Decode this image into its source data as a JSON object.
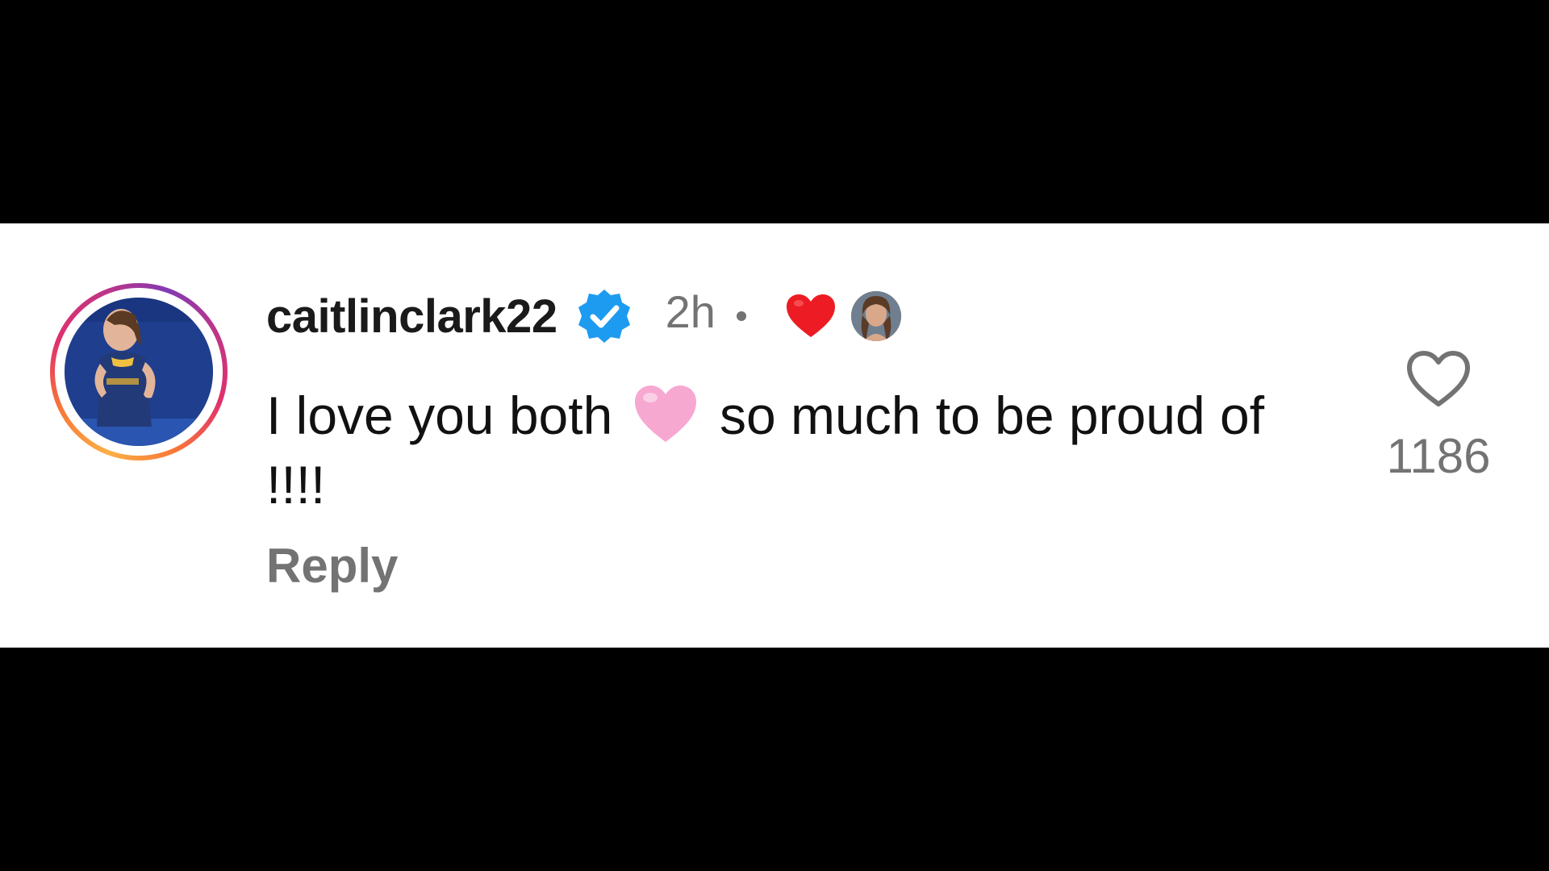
{
  "comment": {
    "username": "caitlinclark22",
    "verified": true,
    "time": "2h",
    "liked_by_author": true,
    "text_before_emoji": "I love you both",
    "text_emoji": "pink-heart",
    "text_after_emoji": "so much to be proud of !!!!",
    "reply_label": "Reply",
    "like_count": "1186"
  },
  "colors": {
    "verified_badge": "#1d9bf0",
    "author_heart": "#ed1c24",
    "pink_heart": "#f7a8d1",
    "muted_text": "#737373"
  },
  "icons": {
    "verified": "verified-badge-icon",
    "author_like": "red-heart-icon",
    "inline_emoji": "pink-heart-icon",
    "like": "heart-outline-icon"
  }
}
